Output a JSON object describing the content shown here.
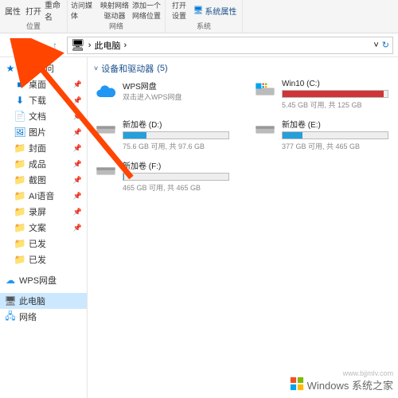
{
  "ribbon": {
    "g1_a": "属性",
    "g1_b": "打开",
    "g1_c": "重命名",
    "g1_label": "位置",
    "g2_a": "访问媒体",
    "g2_b": "映射网络\n驱动器",
    "g2_c": "添加一个\n网络位置",
    "g2_label": "网络",
    "g3_a": "打开\n设置",
    "g3_sysprops": "系统属性",
    "g3_label": "系统"
  },
  "nav": {
    "location": "此电脑",
    "sep": "›"
  },
  "sidebar": {
    "quick": "快速访问",
    "items": [
      {
        "label": "桌面",
        "pinned": true
      },
      {
        "label": "下载",
        "pinned": true
      },
      {
        "label": "文档",
        "pinned": true
      },
      {
        "label": "图片",
        "pinned": true
      },
      {
        "label": "封面",
        "pinned": true
      },
      {
        "label": "成品",
        "pinned": true
      },
      {
        "label": "截图",
        "pinned": true
      },
      {
        "label": "AI语音",
        "pinned": true
      },
      {
        "label": "录屏",
        "pinned": true
      },
      {
        "label": "文案",
        "pinned": true
      },
      {
        "label": "已发",
        "pinned": false
      },
      {
        "label": "已发",
        "pinned": false
      }
    ],
    "wps": "WPS网盘",
    "thispc": "此电脑",
    "network": "网络"
  },
  "section": {
    "title": "设备和驱动器",
    "count": "(5)"
  },
  "drives": [
    {
      "name": "WPS网盘",
      "sub": "双击进入WPS网盘",
      "type": "cloud"
    },
    {
      "name": "Win10 (C:)",
      "stats": "5.45 GB 可用, 共 125 GB",
      "type": "os",
      "fill": 96,
      "color": "red"
    },
    {
      "name": "新加卷 (D:)",
      "stats": "75.6 GB 可用, 共 97.6 GB",
      "type": "hdd",
      "fill": 22,
      "color": "blue"
    },
    {
      "name": "新加卷 (E:)",
      "stats": "377 GB 可用, 共 465 GB",
      "type": "hdd",
      "fill": 19,
      "color": "blue"
    },
    {
      "name": "新加卷 (F:)",
      "stats": "465 GB 可用, 共 465 GB",
      "type": "hdd",
      "fill": 1,
      "color": "blue"
    }
  ],
  "watermark": {
    "text": "Windows 系统之家",
    "credit": "www.bjjmlv.com"
  }
}
